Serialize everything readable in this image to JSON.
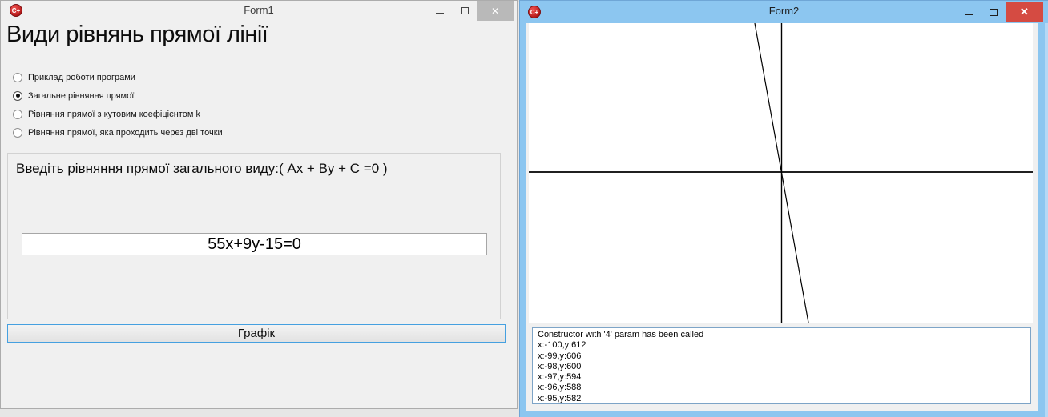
{
  "form1": {
    "title": "Form1",
    "header": "Види рівнянь прямої лінії",
    "radios": [
      {
        "label": "Приклад роботи програми",
        "selected": false
      },
      {
        "label": "Загальне рівняння прямої",
        "selected": true
      },
      {
        "label": "Рівняння прямої з кутовим коефіцієнтом k",
        "selected": false
      },
      {
        "label": "Рівняння прямої, яка проходить через дві точки",
        "selected": false
      }
    ],
    "panel_label": "Введіть рівняння прямої загального виду:( Ax + By + C =0 )",
    "equation_value": "55x+9y-15=0",
    "graph_button_label": "Графік",
    "caption": {
      "minimize": "minimize",
      "maximize": "maximize",
      "close": "✕"
    }
  },
  "form2": {
    "title": "Form2",
    "caption": {
      "minimize": "minimize",
      "maximize": "maximize",
      "close": "✕"
    },
    "log_lines": [
      "Constructor with '4' param has been called",
      "x:-100,y:612",
      "x:-99,y:606",
      "x:-98,y:600",
      "x:-97,y:594",
      "x:-96,y:588",
      "x:-95,y:582"
    ],
    "graph": {
      "equation": "55x+9y-15=0",
      "axis_y": {
        "x1": "315.5",
        "y1": "0",
        "x2": "315.5",
        "y2": "374"
      },
      "axis_x": {
        "x1": "0",
        "y1": "186",
        "x2": "629",
        "y2": "186"
      },
      "plotted_line": {
        "x1": "282",
        "y1": "0",
        "x2": "349",
        "y2": "374"
      }
    }
  },
  "icons": {
    "app_icon_glyph": "C+"
  },
  "colors": {
    "active_titlebar_blue": "#8cc6f0",
    "close_button_red": "#d54b42",
    "inactive_close_gray": "#b9b9b9",
    "focused_button_border": "#45a0e0",
    "listbox_border": "#7da4c7",
    "window_background": "#f0f0f0"
  }
}
